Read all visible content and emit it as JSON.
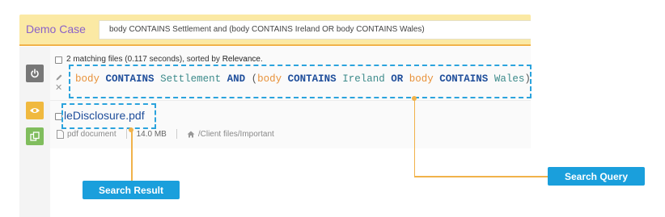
{
  "header": {
    "case_name": "Demo Case",
    "search_query": "body CONTAINS Settlement and (body CONTAINS Ireland OR body CONTAINS Wales)"
  },
  "results": {
    "summary_prefix": "2 matching files (0.117 seconds), sorted by",
    "sort_by": "Relevance",
    "summary_suffix": "."
  },
  "query_display": {
    "field1": "body",
    "kw1": "CONTAINS",
    "term1": "Settlement",
    "op1": "AND",
    "open_paren": "(",
    "field2": "body",
    "kw2": "CONTAINS",
    "term2": "Ireland",
    "op2": "OR",
    "field3": "body",
    "kw3": "CONTAINS",
    "term3": "Wales",
    "close_paren": ")"
  },
  "result_item": {
    "filename": "leDisclosure.pdf",
    "doc_type": "pdf document",
    "size": "14.0 MB",
    "path": "/Client files/Important"
  },
  "callouts": {
    "search_query": "Search Query",
    "search_result": "Search Result"
  },
  "icons": {
    "power": "power-icon",
    "eye": "eye-icon",
    "copy": "copy-icon",
    "edit": "pencil-icon",
    "clear": "close-icon",
    "file": "file-icon",
    "home": "home-icon"
  },
  "colors": {
    "accent_orange": "#f1b24a",
    "callout_blue": "#1a9fdc",
    "case_purple": "#8a61c9"
  }
}
